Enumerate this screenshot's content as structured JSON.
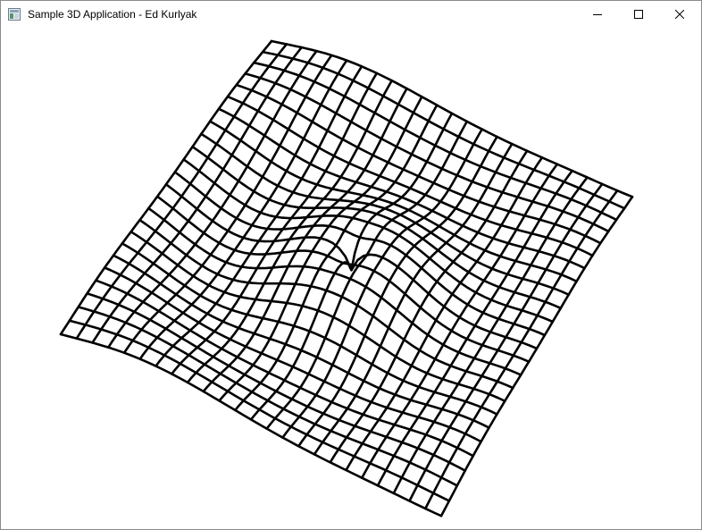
{
  "window": {
    "title": "Sample 3D Application - Ed Kurlyak",
    "app_icon": "application-icon",
    "controls": {
      "minimize_icon": "minimize-icon",
      "maximize_icon": "maximize-icon",
      "close_icon": "close-icon"
    }
  },
  "viewport": {
    "content": "wireframe-surface-mesh",
    "background": "#ffffff",
    "line_color": "#000000"
  }
}
